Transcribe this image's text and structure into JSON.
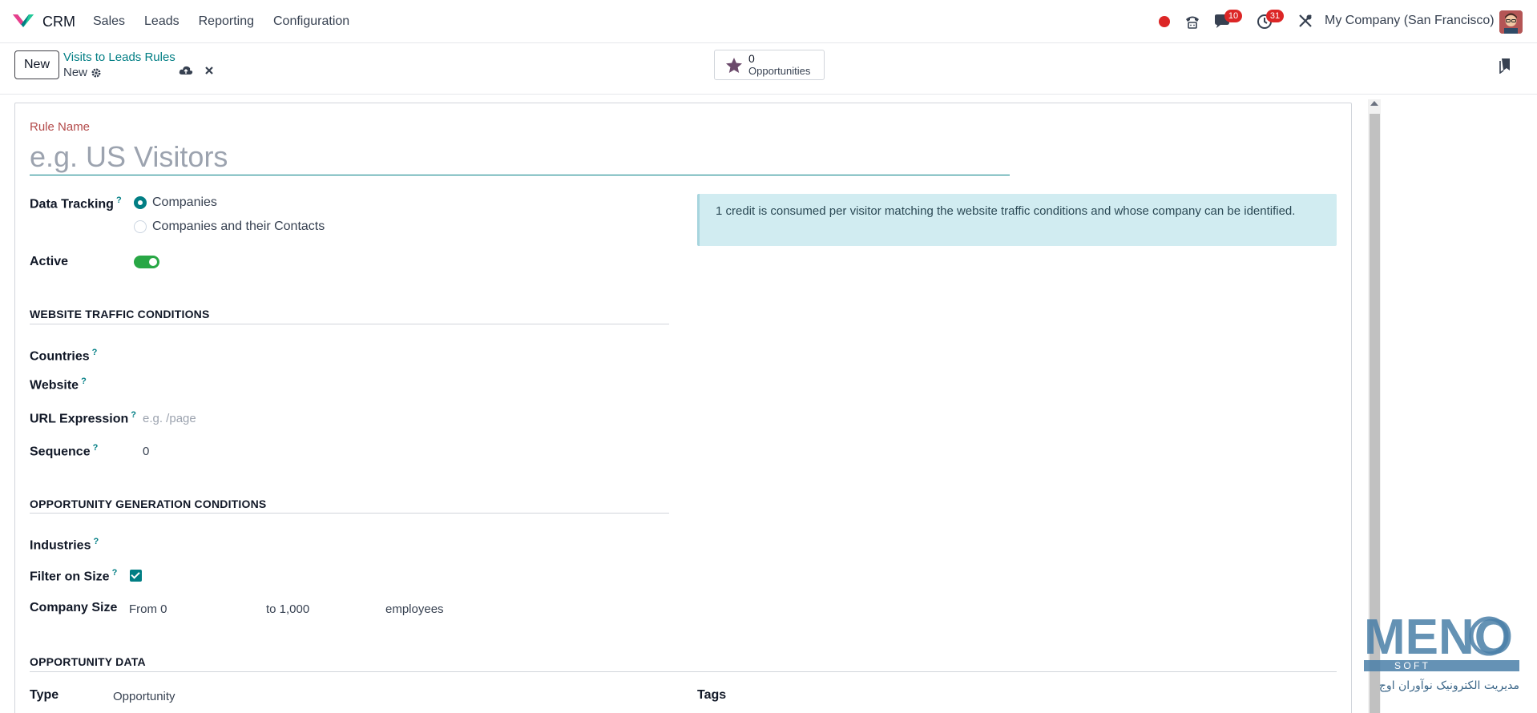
{
  "navbar": {
    "app_name": "CRM",
    "menu": [
      "Sales",
      "Leads",
      "Reporting",
      "Configuration"
    ],
    "messages_badge": "10",
    "activities_badge": "31",
    "company": "My Company (San Francisco)"
  },
  "control": {
    "new_label": "New",
    "breadcrumb_parent": "Visits to Leads Rules",
    "breadcrumb_current": "New",
    "smart_count": "0",
    "smart_label": "Opportunities"
  },
  "form": {
    "rule_name_label": "Rule Name",
    "rule_name_placeholder": "e.g. US Visitors",
    "data_tracking_label": "Data Tracking",
    "tracking_options": [
      "Companies",
      "Companies and their Contacts"
    ],
    "active_label": "Active",
    "alert_text": "1 credit is consumed per visitor matching the website traffic conditions and whose company can be identified.",
    "section_traffic": "WEBSITE TRAFFIC CONDITIONS",
    "countries_label": "Countries",
    "website_label": "Website",
    "url_label": "URL Expression",
    "url_placeholder": "e.g. /page",
    "sequence_label": "Sequence",
    "sequence_value": "0",
    "section_opportunity": "OPPORTUNITY GENERATION CONDITIONS",
    "industries_label": "Industries",
    "filter_size_label": "Filter on Size",
    "company_size_label": "Company Size",
    "size_from": "From 0",
    "size_to": "to 1,000",
    "size_unit": "employees",
    "section_data": "OPPORTUNITY DATA",
    "type_label": "Type",
    "type_value": "Opportunity",
    "tags_label": "Tags",
    "help_mark": "?"
  },
  "watermark": {
    "brand": "MENO",
    "sub": "S O F T",
    "tagline": "مدیریت الکترونیک نوآوران اوج"
  },
  "colors": {
    "accent": "#017e84",
    "required_label": "#b34a4a",
    "badge": "#dc2626",
    "toggle_on": "#28a745",
    "alert_bg": "#d1ecf1"
  }
}
